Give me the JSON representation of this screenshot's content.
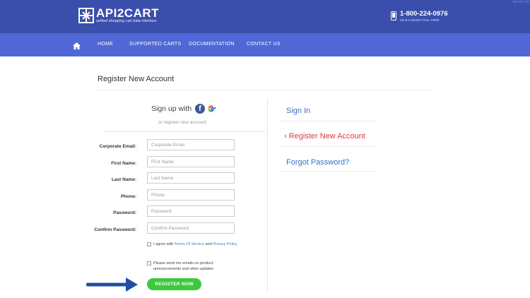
{
  "header": {
    "logo_name": "API2CART",
    "logo_tagline": "unified shopping cart data interface",
    "phone_number": "1-800-224-0976",
    "phone_note": "US & CANADA TOLL FREE",
    "corner_text": "Service St"
  },
  "nav": {
    "home_icon": "home-icon",
    "items": [
      {
        "label": "HOME"
      },
      {
        "label": "SUPPORTED CARTS"
      },
      {
        "label": "DOCUMENTATION"
      },
      {
        "label": "CONTACT US"
      }
    ]
  },
  "page": {
    "title": "Register New Account"
  },
  "signup": {
    "heading": "Sign up with",
    "facebook_glyph": "f",
    "google_icon": "google-icon",
    "or_text": "or register new account:"
  },
  "form": {
    "fields": [
      {
        "label": "Corporate Email:",
        "placeholder": "Corporate Email",
        "value": ""
      },
      {
        "label": "First Name:",
        "placeholder": "First Name",
        "value": ""
      },
      {
        "label": "Last Name:",
        "placeholder": "Last Name",
        "value": ""
      },
      {
        "label": "Phone:",
        "placeholder": "Phone",
        "value": ""
      },
      {
        "label": "Password:",
        "placeholder": "Password",
        "value": ""
      },
      {
        "label": "Confirm Password:",
        "placeholder": "Confirm Password",
        "value": ""
      }
    ],
    "agree_prefix": "I agree with",
    "terms_link": "Terms Of Service",
    "agree_and": "and",
    "privacy_link": "Privacy Policy",
    "emails_text": "Please send me emails on product announcements and other updates",
    "register_button": "REGISTER NOW"
  },
  "sidebar": {
    "sign_in": "Sign In",
    "register_marker": "›",
    "register": "Register New Account",
    "forgot": "Forgot Password?"
  },
  "colors": {
    "header_bg": "#3a4eab",
    "nav_bg": "#5068d6",
    "link_blue": "#3a6fbf",
    "active_red": "#e03a3a",
    "button_green": "#3ec93e",
    "arrow_blue": "#1f4ea3"
  }
}
